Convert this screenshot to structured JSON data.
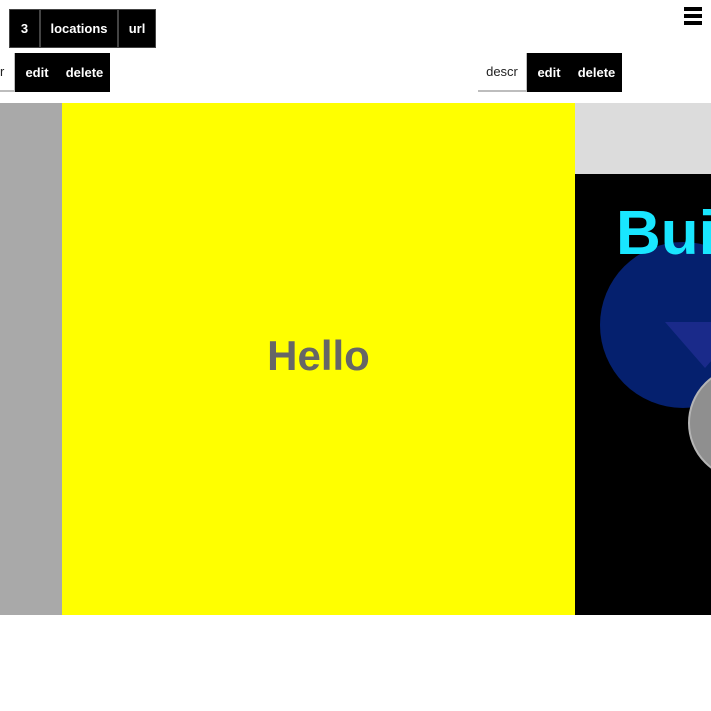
{
  "topbar": {
    "count": "3",
    "locations_label": "locations",
    "url_label": "url"
  },
  "menu": {
    "icon": "hamburger-icon"
  },
  "left_toolbar": {
    "descr_partial": "r",
    "edit_label": "edit",
    "delete_label": "delete"
  },
  "right_toolbar": {
    "descr_label": "descr",
    "edit_label": "edit",
    "delete_label": "delete"
  },
  "slides": {
    "center": {
      "text": "Hello",
      "background": "#ffff00",
      "text_color": "#666666"
    },
    "right": {
      "text": "Bui",
      "text_color": "#19e6ff",
      "background": "#000000",
      "band_color": "#dcdcdc"
    },
    "left": {
      "background": "#a9a9a9"
    }
  }
}
